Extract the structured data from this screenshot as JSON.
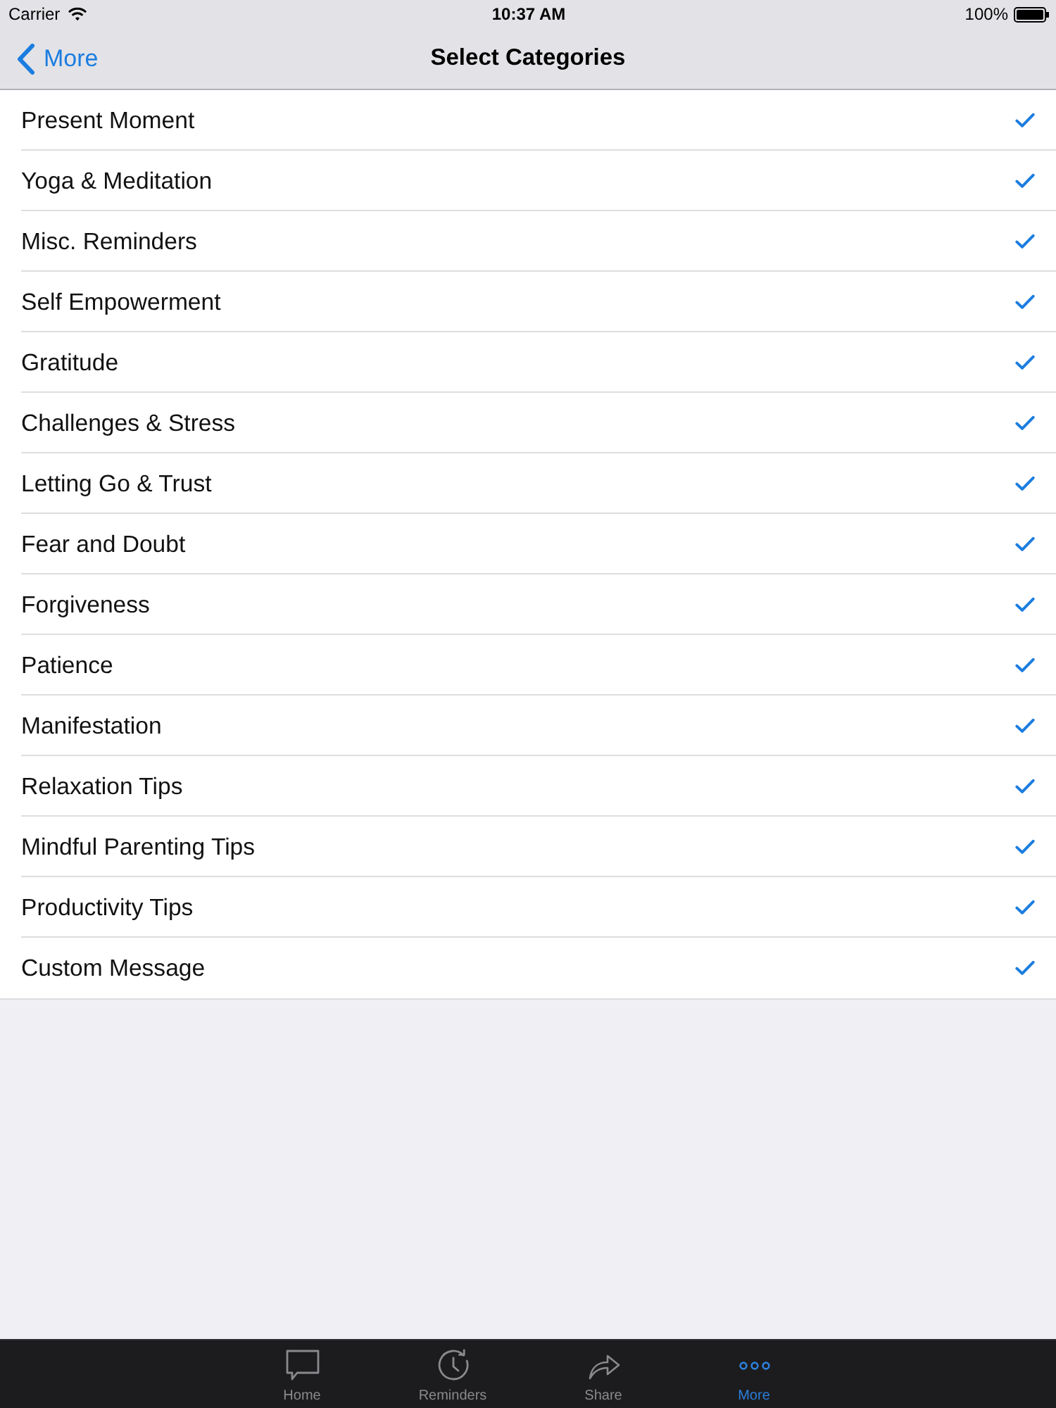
{
  "status_bar": {
    "carrier": "Carrier",
    "time": "10:37 AM",
    "battery": "100%"
  },
  "nav_bar": {
    "back": "More",
    "title": "Select Categories"
  },
  "categories": [
    {
      "label": "Present Moment",
      "checked": true
    },
    {
      "label": "Yoga & Meditation",
      "checked": true
    },
    {
      "label": "Misc. Reminders",
      "checked": true
    },
    {
      "label": "Self Empowerment",
      "checked": true
    },
    {
      "label": "Gratitude",
      "checked": true
    },
    {
      "label": "Challenges & Stress",
      "checked": true
    },
    {
      "label": "Letting Go & Trust",
      "checked": true
    },
    {
      "label": "Fear and Doubt",
      "checked": true
    },
    {
      "label": "Forgiveness",
      "checked": true
    },
    {
      "label": "Patience",
      "checked": true
    },
    {
      "label": "Manifestation",
      "checked": true
    },
    {
      "label": "Relaxation Tips",
      "checked": true
    },
    {
      "label": "Mindful Parenting Tips",
      "checked": true
    },
    {
      "label": "Productivity Tips",
      "checked": true
    },
    {
      "label": "Custom Message",
      "checked": true
    }
  ],
  "tab_bar": [
    {
      "label": "Home",
      "selected": false
    },
    {
      "label": "Reminders",
      "selected": false
    },
    {
      "label": "Share",
      "selected": false
    },
    {
      "label": "More",
      "selected": true
    }
  ]
}
